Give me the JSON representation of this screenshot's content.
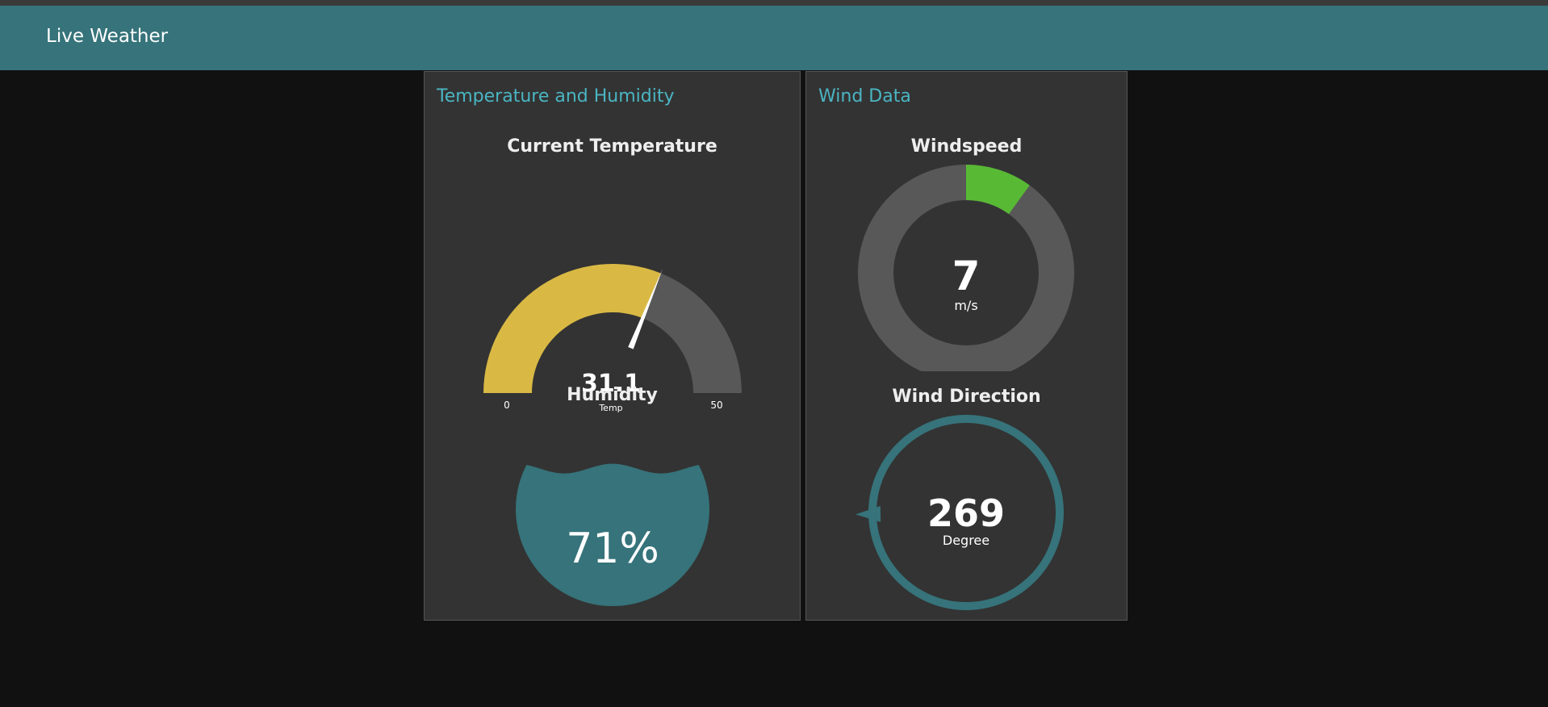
{
  "app": {
    "title": "Live Weather"
  },
  "colors": {
    "header": "#36737a",
    "accent": "#4ab5c2",
    "gauge_fill": "#d9b944",
    "gauge_track": "#585858",
    "wind_fill": "#58b935",
    "teal": "#36737a"
  },
  "temperature_card": {
    "title": "Temperature and Humidity",
    "temperature": {
      "label": "Current Temperature",
      "value": "31.1",
      "value_num": 31.1,
      "units": "Temp",
      "min": "0",
      "min_num": 0,
      "max": "50",
      "max_num": 50
    },
    "humidity": {
      "label": "Humidity",
      "value": "71%",
      "percent": 71
    }
  },
  "wind_card": {
    "title": "Wind Data",
    "windspeed": {
      "label": "Windspeed",
      "value": "7",
      "value_num": 7,
      "units": "m/s",
      "max_num": 70
    },
    "direction": {
      "label": "Wind Direction",
      "value": "269",
      "degrees": 269,
      "units": "Degree"
    }
  }
}
